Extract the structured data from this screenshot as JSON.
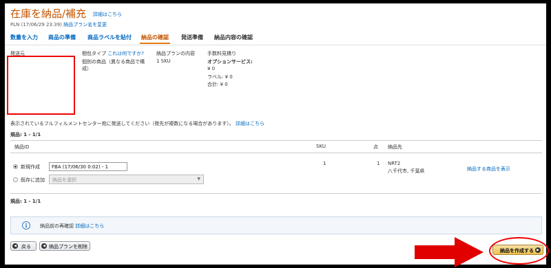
{
  "header": {
    "title": "在庫を納品/補充",
    "title_link": "詳細はこちら",
    "plan_info": "PLN (17/06/29 23:39)",
    "rename_link": "納品プラン名を変更"
  },
  "tabs": [
    {
      "label": "数量を入力"
    },
    {
      "label": "商品の準備"
    },
    {
      "label": "商品ラベルを貼付"
    },
    {
      "label": "納品の確認"
    },
    {
      "label": "発送準備"
    },
    {
      "label": "納品内容の確認"
    }
  ],
  "summary": {
    "ship_from_label": "発送元",
    "packing_type_label": "梱包タイプ",
    "packing_type_help": "これは何ですか?",
    "packing_type_value": "個別の商品（異なる商品で構成）",
    "plan_contents_label": "納品プランの内容",
    "plan_contents_value": "1 SKU",
    "fee_label": "手数料見積り",
    "option_service_label": "オプションサービス:",
    "option_service_value": "¥ 0",
    "label_fee": "ラベル: ¥ 0",
    "total": "合計: ¥ 0"
  },
  "notice": {
    "text": "表示されているフルフィルメントセンター宛に発送してください（発先が複数になる場合があります）。",
    "link": "詳細はこちら"
  },
  "pagination_top": "規品: 1 - 1/1",
  "table": {
    "col_id": "納品ID",
    "col_sku": "SKU",
    "col_units": "点",
    "col_dest": "納品先",
    "new_option_label": "新規作成",
    "new_shipment_name": "FBA (17/06/30 0:02) - 1",
    "existing_option_label": "既存に追加",
    "select_placeholder": "納品を選択",
    "sku_count": "1",
    "units": "1",
    "dest_code": "NRT2",
    "dest_city": "八千代市, 千葉県",
    "view_items_link": "納品する商品を表示"
  },
  "pagination_bottom": "規品: 1 - 1/1",
  "info": {
    "text": "納品前の再確認",
    "link": "詳細はこちら"
  },
  "buttons": {
    "back": "戻る",
    "delete_plan": "納品プランを削除",
    "create": "納品を作成する"
  },
  "colors": {
    "accent": "#c45500",
    "link": "#0066c0",
    "highlight": "#e00000",
    "primary_button": "#f0c14b"
  }
}
